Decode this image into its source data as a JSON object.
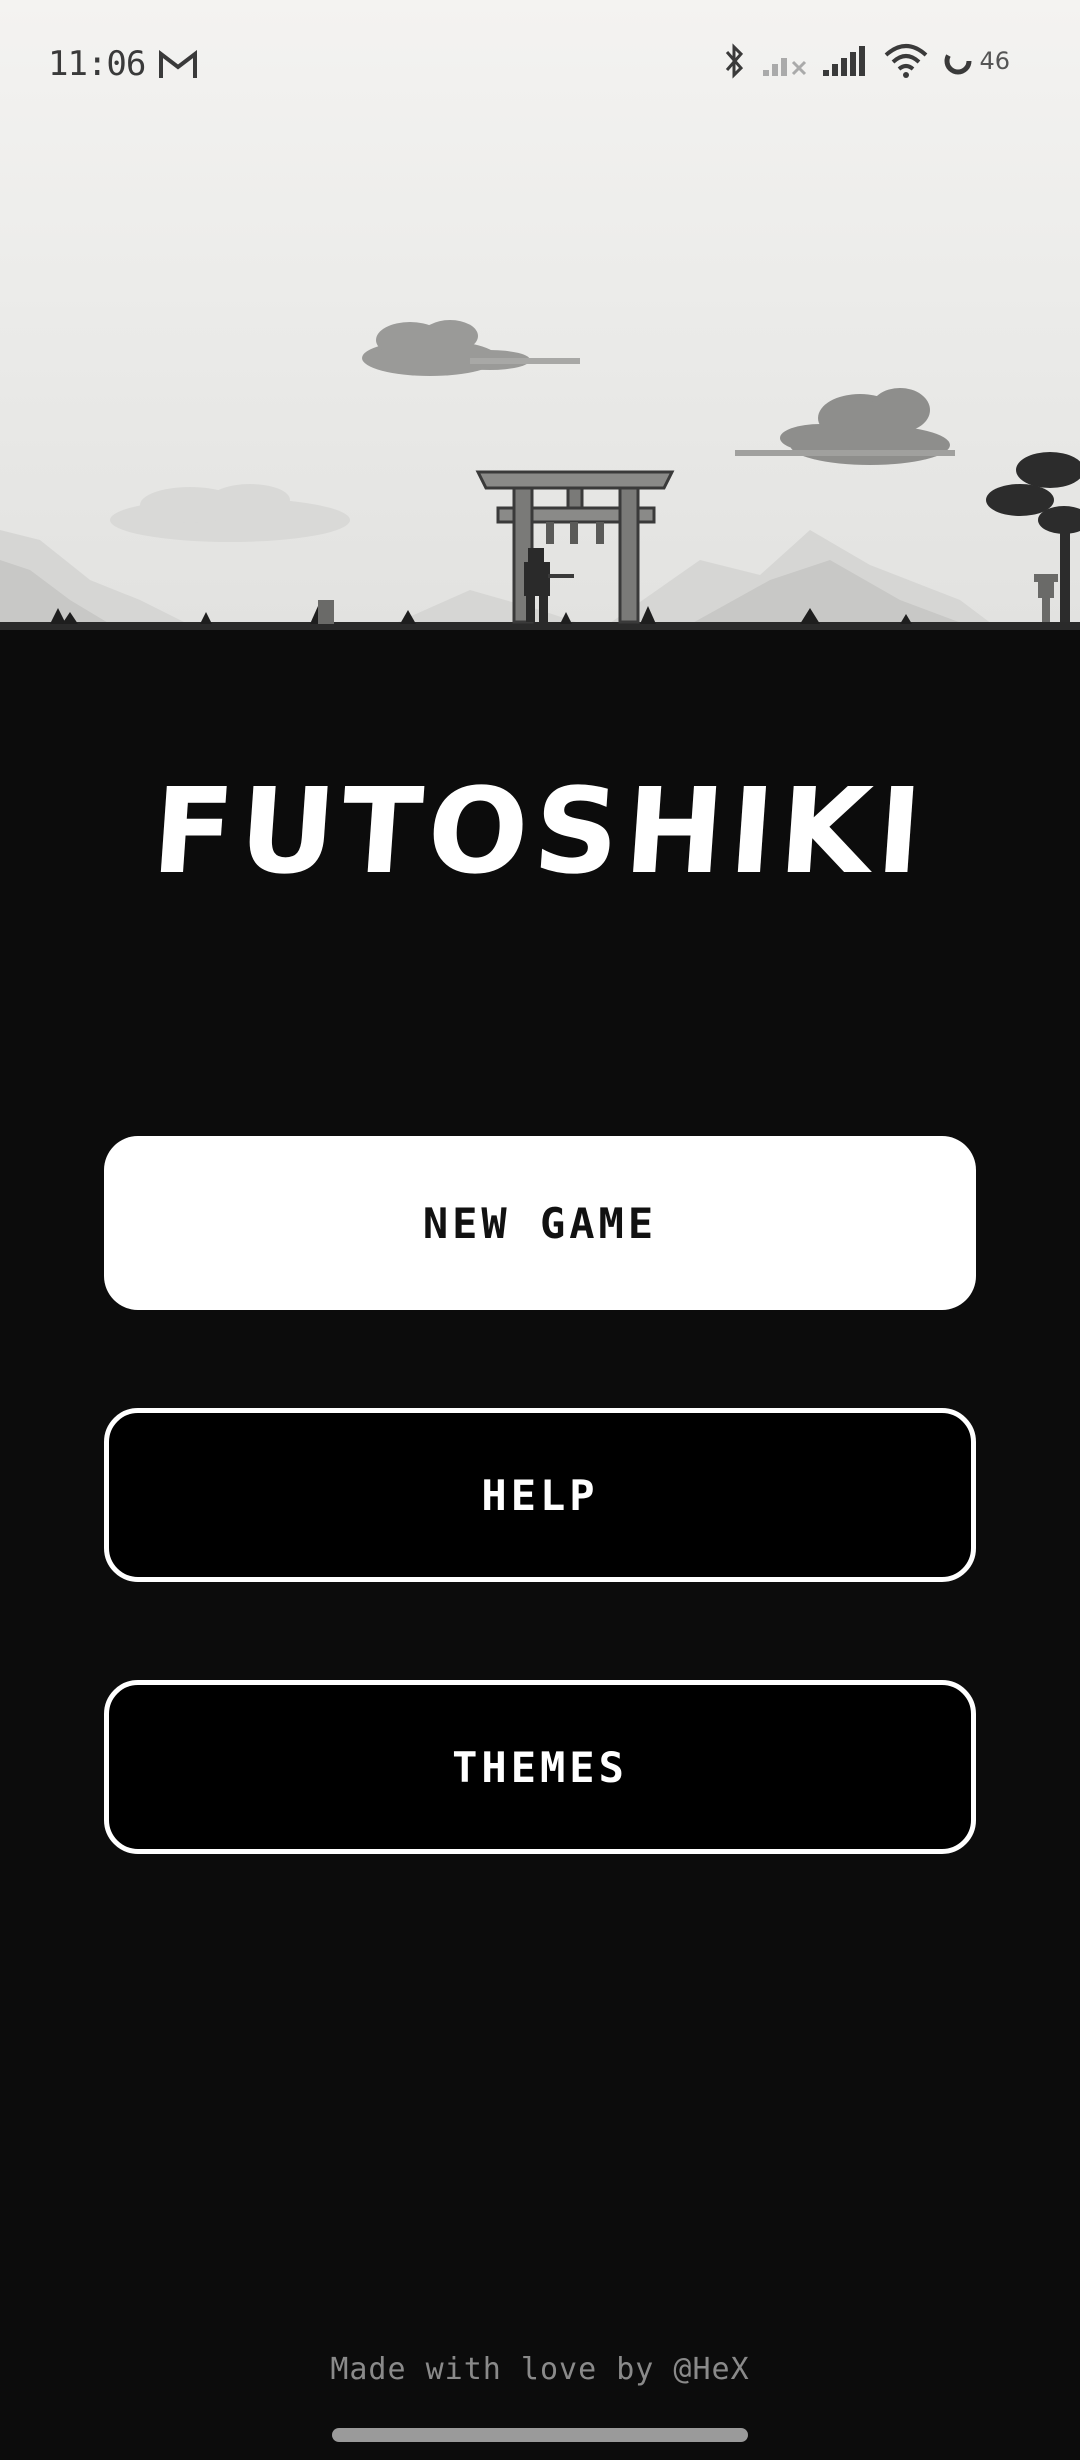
{
  "status_bar": {
    "time": "11:06",
    "battery_level": "46",
    "icons": [
      "gmail-icon",
      "bluetooth-icon",
      "signal-off-icon",
      "signal-icon",
      "wifi-icon",
      "battery-icon"
    ]
  },
  "scene": {
    "description_icons": [
      "torii-gate",
      "samurai",
      "clouds",
      "mountains",
      "bonsai-tree",
      "stone-lantern"
    ]
  },
  "title": "FUTOSHIKI",
  "menu": {
    "new_game": "NEW GAME",
    "help": "HELP",
    "themes": "THEMES"
  },
  "footer": {
    "credit": "Made with love by @HeX"
  },
  "colors": {
    "background": "#0c0c0c",
    "primary_button": "#ffffff",
    "outline_button_border": "#ffffff",
    "sky": "#f2f2f0"
  }
}
